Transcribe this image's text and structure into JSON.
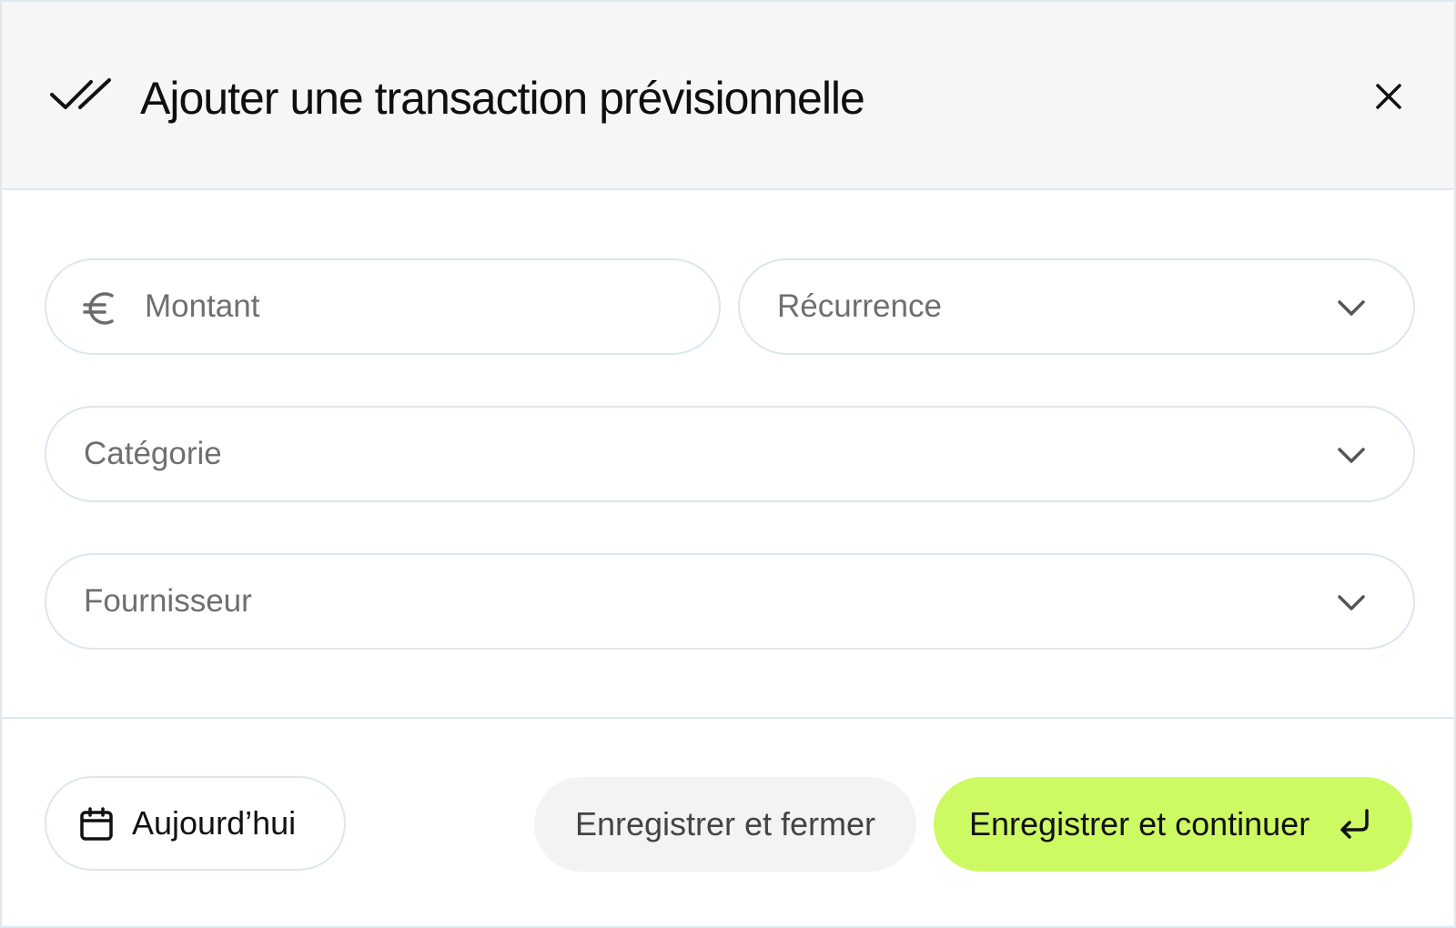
{
  "dialog": {
    "title": "Ajouter une transaction prévisionnelle",
    "header_icon": "double-check-icon",
    "close_icon": "close-icon"
  },
  "form": {
    "amount": {
      "placeholder": "Montant",
      "icon": "euro-icon"
    },
    "recurrence": {
      "placeholder": "Récurrence",
      "icon": "chevron-down-icon"
    },
    "category": {
      "placeholder": "Catégorie",
      "icon": "chevron-down-icon"
    },
    "supplier": {
      "placeholder": "Fournisseur",
      "icon": "chevron-down-icon"
    }
  },
  "footer": {
    "date_label": "Aujourd’hui",
    "date_icon": "calendar-icon",
    "save_close_label": "Enregistrer et fermer",
    "save_continue_label": "Enregistrer et continuer",
    "save_continue_icon": "enter-icon"
  },
  "colors": {
    "header_bg": "#f6f6f6",
    "border": "#dce6f0",
    "primary_button": "#cdf962",
    "secondary_button": "#f3f3f3",
    "placeholder_text": "#6f6f6f"
  }
}
